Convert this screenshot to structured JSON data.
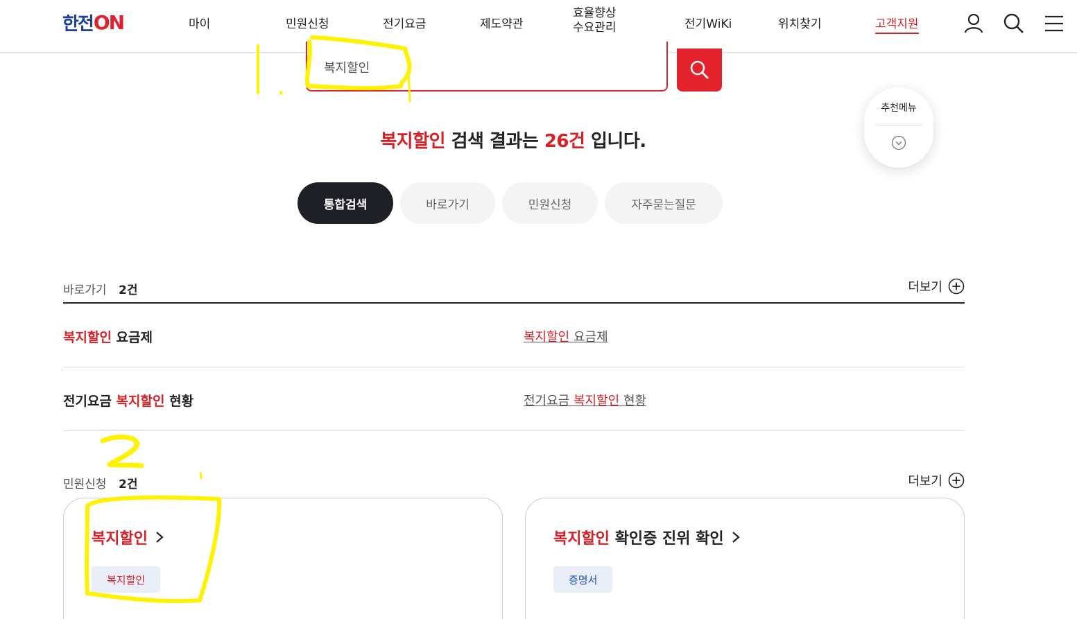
{
  "header": {
    "logo_han": "한전",
    "logo_on": "ON",
    "nav": [
      {
        "label": "마이"
      },
      {
        "label": "민원신청"
      },
      {
        "label": "전기요금"
      },
      {
        "label": "제도약관"
      },
      {
        "label_line1": "효율향상",
        "label_line2": "수요관리"
      },
      {
        "label": "전기WiKi"
      },
      {
        "label": "위치찾기"
      },
      {
        "label": "고객지원"
      }
    ],
    "icons": [
      "user-icon",
      "search-icon",
      "menu-icon"
    ]
  },
  "search": {
    "value": "복지할인",
    "button_icon": "search-icon"
  },
  "result": {
    "keyword": "복지할인",
    "middle": " 검색 결과는 ",
    "count": "26건",
    "suffix": " 입니다."
  },
  "recommend": {
    "label": "추천메뉴",
    "icon": "chevron-down-icon"
  },
  "tabs": [
    {
      "label": "통합검색",
      "active": true
    },
    {
      "label": "바로가기",
      "active": false
    },
    {
      "label": "민원신청",
      "active": false
    },
    {
      "label": "자주묻는질문",
      "active": false
    }
  ],
  "shortcut_section": {
    "title": "바로가기",
    "count": "2건",
    "more": "더보기",
    "rows": [
      {
        "title_red": "복지할인",
        "title_rest": " 요금제",
        "link_red": "복지할인",
        "link_rest": " 요금제"
      },
      {
        "title_pre": "전기요금 ",
        "title_red": "복지할인",
        "title_rest": " 현황",
        "link_pre": "전기요금 ",
        "link_red": "복지할인",
        "link_rest": " 현황"
      }
    ]
  },
  "civil_section": {
    "title": "민원신청",
    "count": "2건",
    "more": "더보기",
    "cards": [
      {
        "title_red": "복지할인",
        "title_rest": "",
        "tag": "복지할인"
      },
      {
        "title_red": "복지할인",
        "title_rest": " 확인증 진위 확인",
        "tag": "증명서"
      }
    ]
  },
  "annotations": {
    "mark1": "1.",
    "mark2": "2"
  },
  "colors": {
    "accent_red": "#e3222b",
    "brand_blue": "#1a3fa0",
    "dark_tab": "#1f2025",
    "tag_bg": "#e9eef8",
    "annotation_yellow": "#fff200"
  }
}
